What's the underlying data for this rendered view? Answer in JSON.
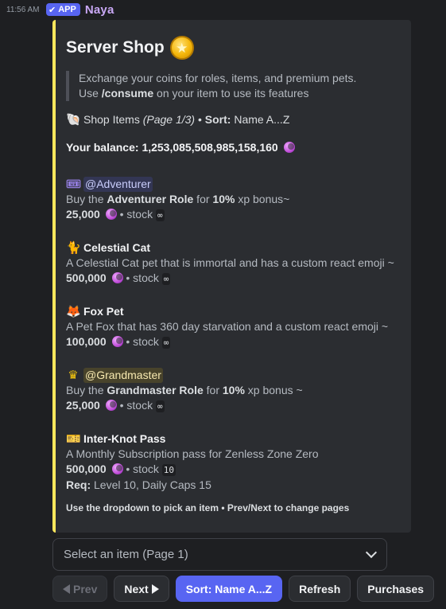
{
  "message": {
    "timestamp": "11:56 AM",
    "app_badge": "APP",
    "username": "Naya"
  },
  "embed": {
    "accent_color": "#fee75c",
    "title": "Server Shop",
    "quote_line1": "Exchange your coins for roles, items, and premium pets.",
    "quote_line2_prefix": "Use ",
    "quote_line2_cmd": "/consume",
    "quote_line2_suffix": " on your item to use its features",
    "shop_label": "Shop Items",
    "page_label": "(Page 1/3)",
    "sort_sep": " • ",
    "sort_label": "Sort:",
    "sort_value": "Name A...Z",
    "balance_label": "Your balance:",
    "balance_value": "1,253,085,508,985,158,160",
    "items": [
      {
        "icon": "ticket-icon",
        "name": "@Adventurer",
        "is_mention": true,
        "desc_prefix": "Buy the ",
        "desc_bold": "Adventurer Role",
        "desc_mid": " for ",
        "desc_bold2": "10%",
        "desc_suffix": " xp bonus~",
        "price": "25,000",
        "stock_label": "• stock",
        "stock": "∞"
      },
      {
        "icon": "cat-icon",
        "name": "Celestial Cat",
        "is_mention": false,
        "desc": "A Celestial Cat pet that is immortal and has a custom react emoji ~",
        "price": "500,000",
        "stock_label": "• stock",
        "stock": "∞"
      },
      {
        "icon": "fox-icon",
        "name": "Fox Pet",
        "is_mention": false,
        "desc": "A Pet Fox that has 360 day starvation and a custom react emoji ~",
        "price": "100,000",
        "stock_label": "• stock",
        "stock": "∞"
      },
      {
        "icon": "crown-icon",
        "name": "@Grandmaster",
        "is_mention": true,
        "desc_prefix": "Buy the ",
        "desc_bold": "Grandmaster Role",
        "desc_mid": " for ",
        "desc_bold2": "10%",
        "desc_suffix": " xp bonus ~",
        "price": "25,000",
        "stock_label": "• stock",
        "stock": "∞"
      },
      {
        "icon": "pass-icon",
        "name": "Inter-Knot Pass",
        "is_mention": false,
        "desc": "A Monthly Subscription pass for Zenless Zone Zero",
        "price": "500,000",
        "stock_label": "• stock",
        "stock": "10",
        "req_label": "Req:",
        "req_value": "Level 10, Daily Caps 15"
      }
    ],
    "footer": "Use the dropdown to pick an item • Prev/Next to change pages"
  },
  "select": {
    "placeholder": "Select an item (Page 1)"
  },
  "buttons": {
    "prev": "Prev",
    "next": "Next",
    "sort": "Sort: Name A...Z",
    "refresh": "Refresh",
    "purchases": "Purchases"
  },
  "colors": {
    "brand": "#5865f2",
    "background": "#1e1f22",
    "embed_bg": "#2b2d31"
  }
}
